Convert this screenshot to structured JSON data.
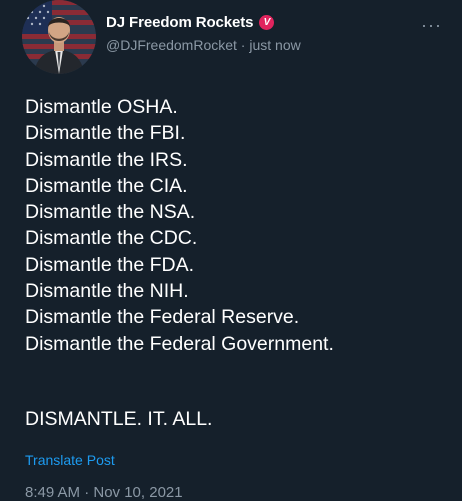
{
  "author": {
    "display_name": "DJ Freedom Rockets",
    "badge": "V",
    "handle_line": "@DJFreedomRocket · just now",
    "avatar": "avatar-photo"
  },
  "menu": {
    "more_label": "···"
  },
  "tweet": {
    "lines": [
      "Dismantle OSHA.",
      "Dismantle the FBI.",
      "Dismantle the IRS.",
      "Dismantle the CIA.",
      "Dismantle the NSA.",
      "Dismantle the CDC.",
      "Dismantle the FDA.",
      "Dismantle the NIH.",
      "Dismantle the Federal Reserve.",
      "Dismantle the Federal Government."
    ],
    "final_line": "DISMANTLE. IT. ALL."
  },
  "translate_label": "Translate Post",
  "timestamp": "8:49 AM · Nov 10, 2021",
  "colors": {
    "background": "#15202b",
    "text": "#ffffff",
    "secondary": "#8b98a5",
    "link": "#1d9bf0",
    "badge": "#e0245e"
  }
}
